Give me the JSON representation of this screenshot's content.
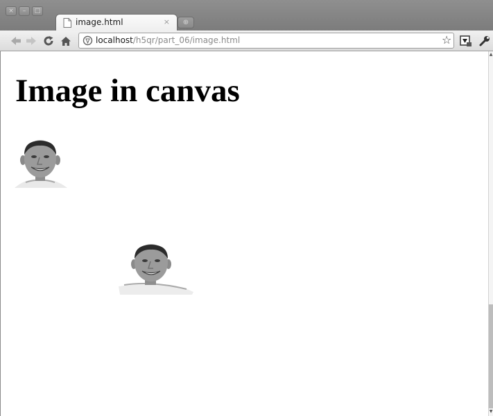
{
  "window": {
    "controls": [
      "close",
      "minimize",
      "maximize"
    ],
    "control_glyphs": {
      "close": "×",
      "minimize": "–",
      "maximize": "□"
    }
  },
  "tabs": [
    {
      "title": "image.html",
      "active": true,
      "icon": "page-icon"
    }
  ],
  "tab_close_glyph": "×",
  "new_tab_glyph": "⊕",
  "toolbar": {
    "url_host": "localhost",
    "url_path": "/h5qr/part_06/image.html",
    "star_glyph": "☆",
    "icons": [
      "back-icon",
      "forward-icon",
      "reload-icon",
      "home-icon",
      "globe-icon",
      "star-icon",
      "page-action-icon",
      "wrench-icon"
    ]
  },
  "page": {
    "heading": "Image in canvas",
    "images": [
      "face-image",
      "face-image"
    ]
  },
  "colors": {
    "titlebar": "#858585",
    "toolbar": "#e6e6e6",
    "page_background": "#ffffff",
    "heading_text": "#000000"
  }
}
